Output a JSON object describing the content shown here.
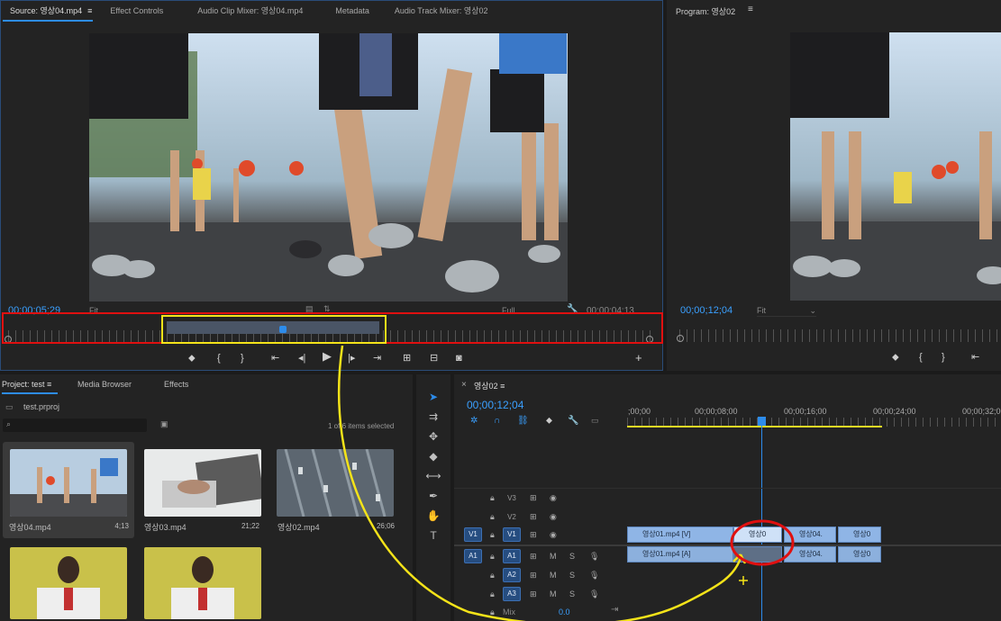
{
  "source_panel": {
    "tabs": [
      {
        "label": "Source: 영상04.mp4",
        "active": true
      },
      {
        "label": "Effect Controls"
      },
      {
        "label": "Audio Clip Mixer: 영상04.mp4"
      },
      {
        "label": "Metadata"
      },
      {
        "label": "Audio Track Mixer: 영상02"
      }
    ],
    "timecode_in": "00;00;05;29",
    "fit_label": "Fit",
    "full_label": "Full",
    "timecode_duration": "00;00;04;13"
  },
  "program_panel": {
    "title": "Program: 영상02",
    "timecode": "00;00;12;04",
    "fit_label": "Fit"
  },
  "project_panel": {
    "tabs": [
      {
        "label": "Project: test",
        "active": true
      },
      {
        "label": "Media Browser"
      },
      {
        "label": "Effects"
      }
    ],
    "project_file": "test.prproj",
    "items_selected": "1 of 6 items selected",
    "items": [
      {
        "name": "영상04.mp4",
        "duration": "4;13",
        "selected": true
      },
      {
        "name": "영상03.mp4",
        "duration": "21;22"
      },
      {
        "name": "영상02.mp4",
        "duration": "26;06"
      },
      {
        "name": "",
        "duration": ""
      },
      {
        "name": "",
        "duration": ""
      }
    ]
  },
  "timeline_panel": {
    "sequence_name": "영상02",
    "close_glyph": "×",
    "timecode": "00;00;12;04",
    "ruler_labels": [
      ";00;00",
      "00;00;08;00",
      "00;00;16;00",
      "00;00;24;00",
      "00;00;32;00"
    ],
    "tracks": [
      {
        "label": "V3",
        "target": "",
        "type": "video"
      },
      {
        "label": "V2",
        "target": "",
        "type": "video"
      },
      {
        "label": "V1",
        "target": "V1",
        "type": "video"
      },
      {
        "label": "A1",
        "target": "A1",
        "type": "audio"
      },
      {
        "label": "A2",
        "target": "",
        "type": "audio"
      },
      {
        "label": "A3",
        "target": "",
        "type": "audio"
      }
    ],
    "mix_label": "Mix",
    "mix_value": "0.0",
    "clips_video": [
      "영상01.mp4 [V]",
      "영상0",
      "영상04.",
      "영상0"
    ],
    "clips_audio": [
      "영상01.mp4 [A]",
      "",
      "영상04.",
      "영상0"
    ]
  },
  "colors": {
    "accent_blue": "#2d8ceb",
    "timecode_blue": "#3aa0ff",
    "highlight_red": "#e01010",
    "highlight_yellow": "#f4e319"
  }
}
